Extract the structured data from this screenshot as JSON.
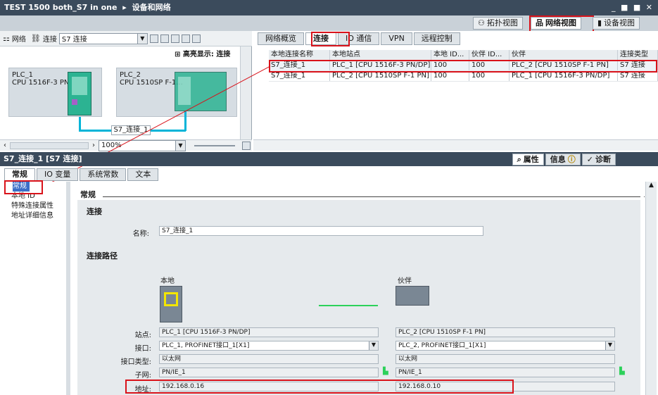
{
  "title": {
    "project": "TEST 1500 both_S7 in one",
    "separator": "▸",
    "section": "设备和网络",
    "controls": "_ ■ ■ ✕"
  },
  "views": {
    "topology": "拓扑视图",
    "network": "网络视图",
    "device": "设备视图"
  },
  "left_toolbar": {
    "network": "网络",
    "connections": "连接",
    "connection_type": "S7 连接",
    "highlight": "高亮显示: 连接",
    "zoom": "100%"
  },
  "devices": [
    {
      "name": "PLC_1",
      "cpu": "CPU 1516F-3 PN..."
    },
    {
      "name": "PLC_2",
      "cpu": "CPU 1510SP F-1..."
    }
  ],
  "connection_label": "S7_连接_1",
  "right_tabs": [
    "网络概览",
    "连接",
    "IO 通信",
    "VPN",
    "远程控制"
  ],
  "conn_table": {
    "headers": [
      "本地连接名称",
      "本地站点",
      "本地 ID...",
      "伙伴 ID...",
      "伙伴",
      "连接类型"
    ],
    "rows": [
      [
        "S7_连接_1",
        "PLC_1 [CPU 1516F-3 PN/DP]",
        "100",
        "100",
        "PLC_2 [CPU 1510SP F-1 PN]",
        "S7 连接"
      ],
      [
        "S7_连接_1",
        "PLC_2 [CPU 1510SP F-1 PN]",
        "100",
        "100",
        "PLC_1 [CPU 1516F-3 PN/DP]",
        "S7 连接"
      ]
    ]
  },
  "props": {
    "title": "S7_连接_1 [S7 连接]",
    "panel_tabs": [
      "属性",
      "信息",
      "诊断"
    ],
    "tabs": [
      "常规",
      "IO 变量",
      "系统常数",
      "文本"
    ],
    "nav": [
      "常规",
      "本地 ID",
      "特殊连接属性",
      "地址详细信息"
    ],
    "section": "常规",
    "group": "连接",
    "name_label": "名称:",
    "name_value": "S7_连接_1",
    "path_title": "连接路径",
    "local": "本地",
    "partner": "伙伴",
    "rows": [
      {
        "label": "站点:",
        "local": "PLC_1 [CPU 1516F-3 PN/DP]",
        "partner": "PLC_2 [CPU 1510SP F-1 PN]"
      },
      {
        "label": "接口:",
        "local": "PLC_1, PROFINET接口_1[X1]",
        "partner": "PLC_2, PROFINET接口_1[X1]"
      },
      {
        "label": "接口类型:",
        "local": "以太网",
        "partner": "以太网"
      },
      {
        "label": "子网:",
        "local": "PN/IE_1",
        "partner": "PN/IE_1"
      },
      {
        "label": "地址:",
        "local": "192.168.0.16",
        "partner": "192.168.0.10"
      }
    ]
  },
  "colors": {
    "titlebar": "#3b4b5c",
    "highlight": "#d9121a",
    "link": "#00b4d8",
    "plc_green": "#2cb392"
  }
}
